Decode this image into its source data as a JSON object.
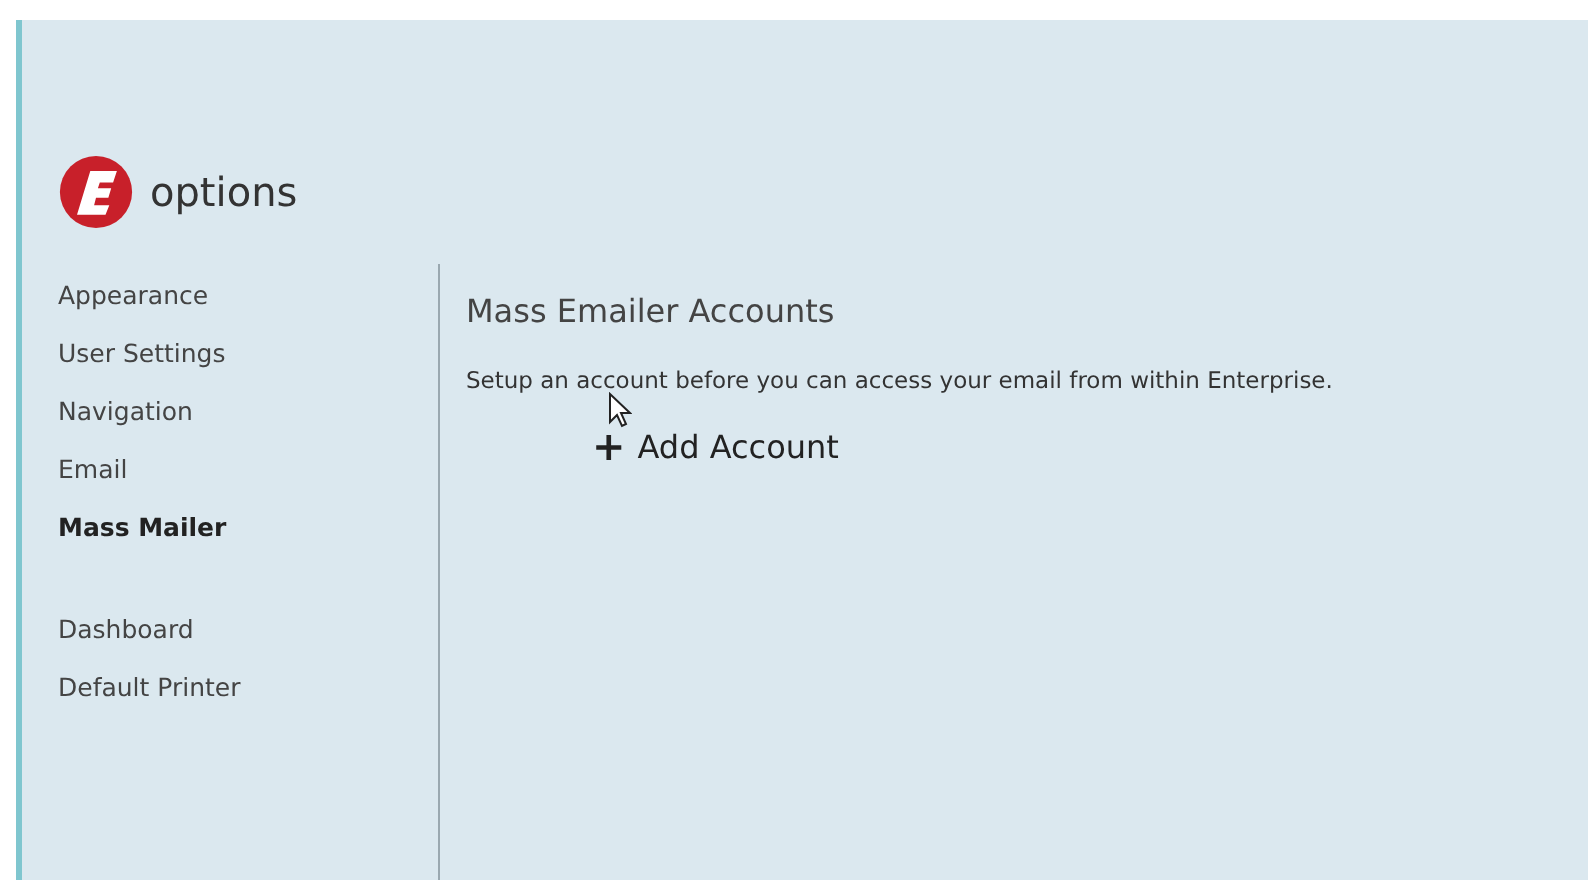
{
  "header": {
    "title": "options"
  },
  "sidebar": {
    "groups": [
      {
        "items": [
          {
            "label": "Appearance",
            "selected": false
          },
          {
            "label": "User Settings",
            "selected": false
          },
          {
            "label": "Navigation",
            "selected": false
          },
          {
            "label": "Email",
            "selected": false
          },
          {
            "label": "Mass Mailer",
            "selected": true
          }
        ]
      },
      {
        "items": [
          {
            "label": "Dashboard",
            "selected": false
          },
          {
            "label": "Default Printer",
            "selected": false
          }
        ]
      }
    ]
  },
  "content": {
    "heading": "Mass Emailer Accounts",
    "description": "Setup an account before you can access your email from within Enterprise.",
    "add_button": {
      "icon": "+",
      "label": "Add Account"
    }
  }
}
